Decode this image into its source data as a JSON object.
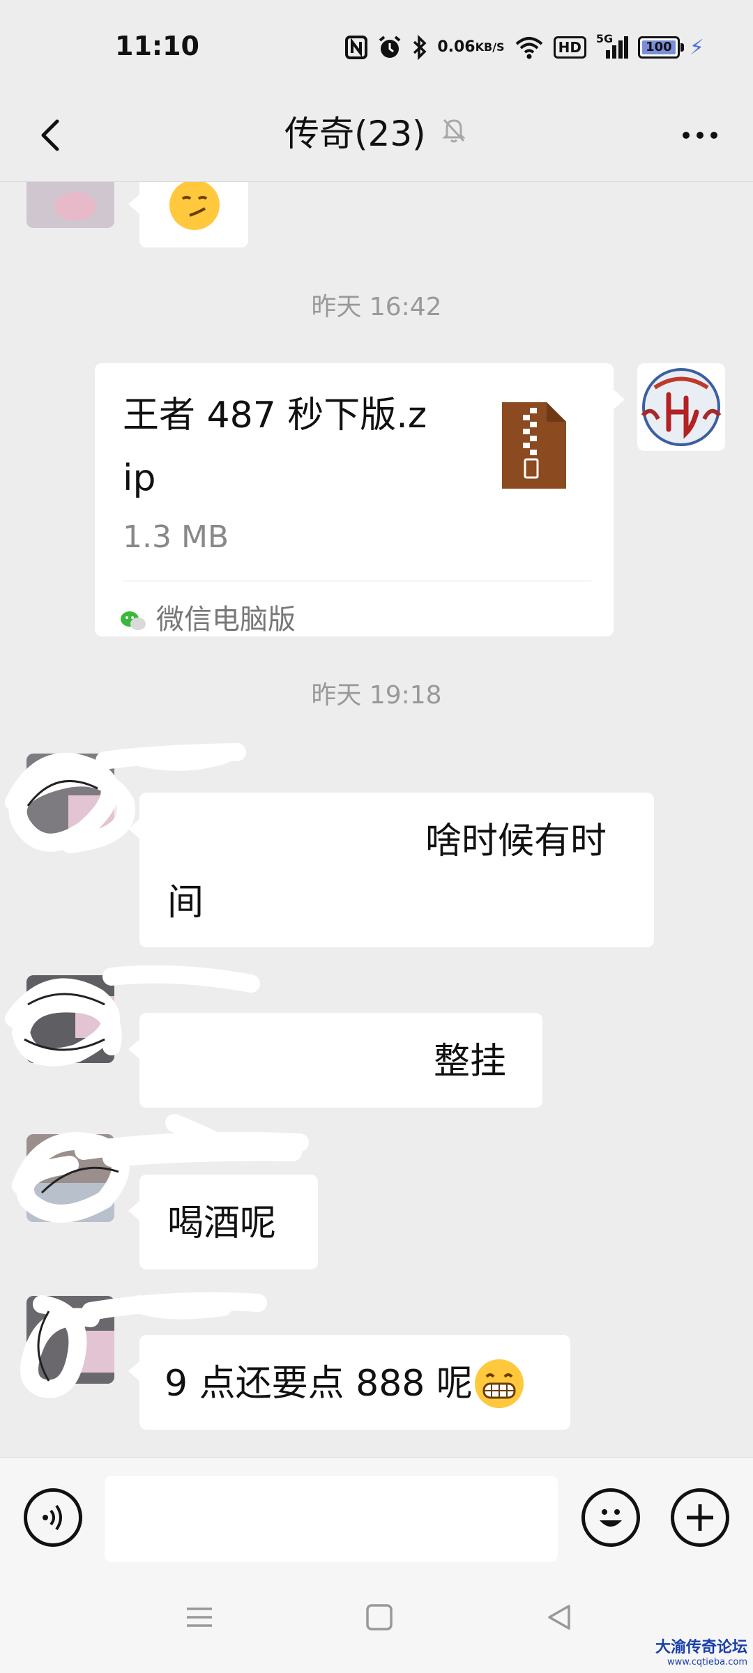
{
  "status_bar": {
    "time": "11:10",
    "net_speed_value": "0.06",
    "net_speed_unit": "KB/S",
    "hd_label": "HD",
    "signal_label": "5G",
    "battery_level": "100"
  },
  "header": {
    "title": "传奇(23)"
  },
  "messages": {
    "timestamp_1": "昨天 16:42",
    "file_name": "王者 487 秒下版.zip",
    "file_size": "1.3 MB",
    "file_source": "微信电脑版",
    "timestamp_2": "昨天 19:18",
    "msg_1_text": "啥时候有时间",
    "msg_2_text": "整挂",
    "msg_3_text": "喝酒呢",
    "msg_4_text": "9 点还要点 888 呢"
  },
  "input": {
    "value": "",
    "placeholder": ""
  },
  "watermark": {
    "title": "大渝传奇论坛",
    "url": "www.cqtieba.com"
  },
  "colors": {
    "background": "#EDEDED",
    "bubble": "#FFFFFF",
    "file_icon": "#8B4A1F",
    "timestamp": "#999999",
    "watermark": "#1B3FA8"
  }
}
